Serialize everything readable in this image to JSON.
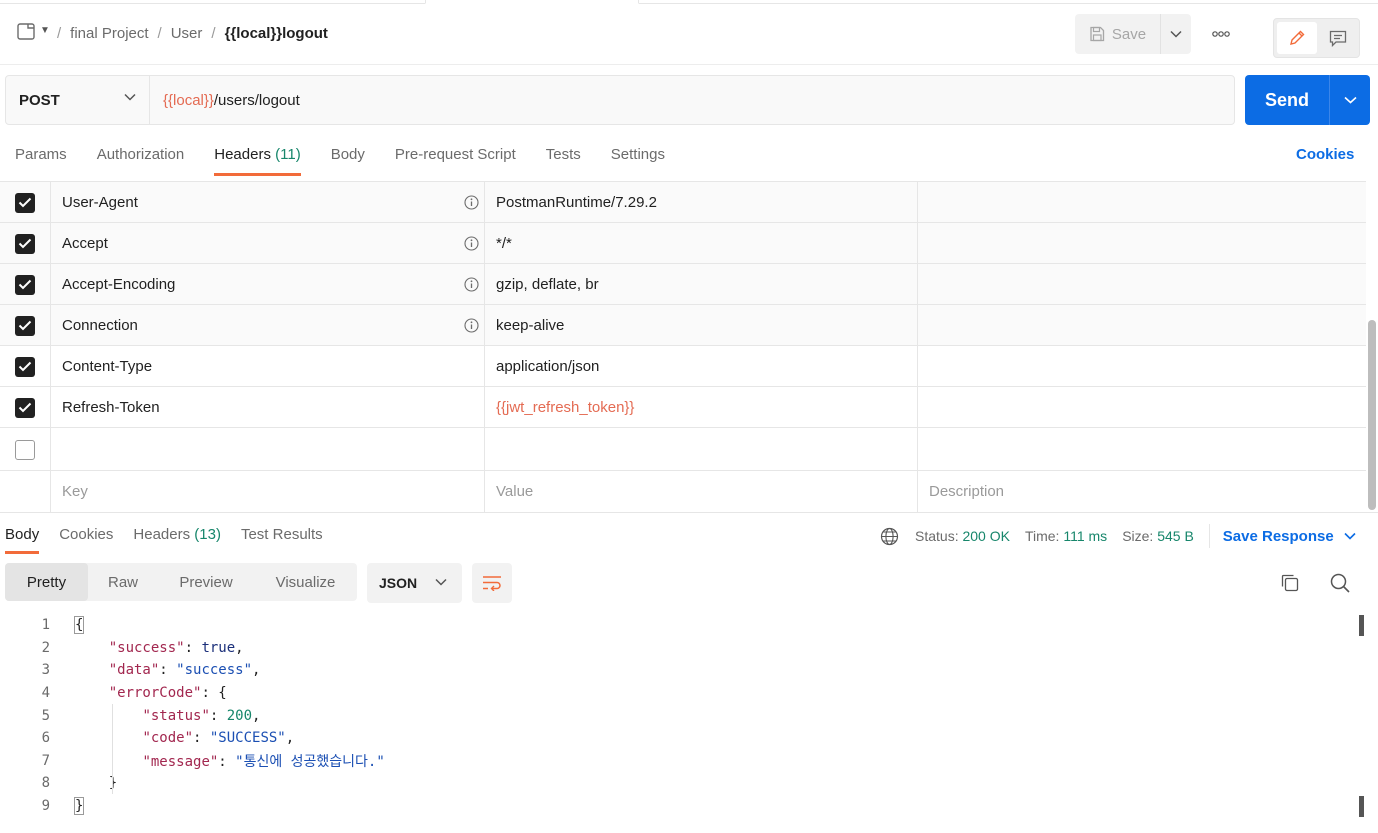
{
  "breadcrumb": {
    "items": [
      "final Project",
      "User"
    ],
    "separator": "/",
    "current": "{{local}}logout"
  },
  "toolbar": {
    "save_label": "Save"
  },
  "request": {
    "method": "POST",
    "url_variable": "{{local}}",
    "url_path": "/users/logout",
    "send_label": "Send"
  },
  "request_tabs": {
    "params": "Params",
    "authorization": "Authorization",
    "headers": "Headers",
    "headers_count": "(11)",
    "body": "Body",
    "prerequest": "Pre-request Script",
    "tests": "Tests",
    "settings": "Settings",
    "cookies": "Cookies"
  },
  "headers_table": {
    "rows": [
      {
        "key": "User-Agent",
        "value": "PostmanRuntime/7.29.2",
        "checked": true,
        "auto": true
      },
      {
        "key": "Accept",
        "value": "*/*",
        "checked": true,
        "auto": true
      },
      {
        "key": "Accept-Encoding",
        "value": "gzip, deflate, br",
        "checked": true,
        "auto": true
      },
      {
        "key": "Connection",
        "value": "keep-alive",
        "checked": true,
        "auto": true
      },
      {
        "key": "Content-Type",
        "value": "application/json",
        "checked": true,
        "auto": false
      },
      {
        "key": "Refresh-Token",
        "value": "{{jwt_refresh_token}}",
        "checked": true,
        "auto": false
      }
    ],
    "placeholder_key": "Key",
    "placeholder_value": "Value",
    "placeholder_description": "Description"
  },
  "response_tabs": {
    "body": "Body",
    "cookies": "Cookies",
    "headers": "Headers",
    "headers_count": "(13)",
    "test_results": "Test Results"
  },
  "response_meta": {
    "status_label": "Status:",
    "status_value": "200 OK",
    "time_label": "Time:",
    "time_value": "111 ms",
    "size_label": "Size:",
    "size_value": "545 B",
    "save_response": "Save Response"
  },
  "response_view": {
    "modes": [
      "Pretty",
      "Raw",
      "Preview",
      "Visualize"
    ],
    "active_mode": "Pretty",
    "format": "JSON"
  },
  "response_body": {
    "line_numbers": [
      "1",
      "2",
      "3",
      "4",
      "5",
      "6",
      "7",
      "8",
      "9"
    ],
    "open_brace": "{",
    "close_brace": "}",
    "success_key": "\"success\"",
    "success_val": "true",
    "data_key": "\"data\"",
    "data_val": "\"success\"",
    "errorcode_key": "\"errorCode\"",
    "status_key": "\"status\"",
    "status_val": "200",
    "code_key": "\"code\"",
    "code_val": "\"SUCCESS\"",
    "message_key": "\"message\"",
    "message_val": "\"통신에 성공했습니다.\""
  },
  "colors": {
    "accent": "#f26b3a",
    "primary": "#0c6ce4",
    "variable": "#e46b53",
    "success": "#17866b"
  }
}
